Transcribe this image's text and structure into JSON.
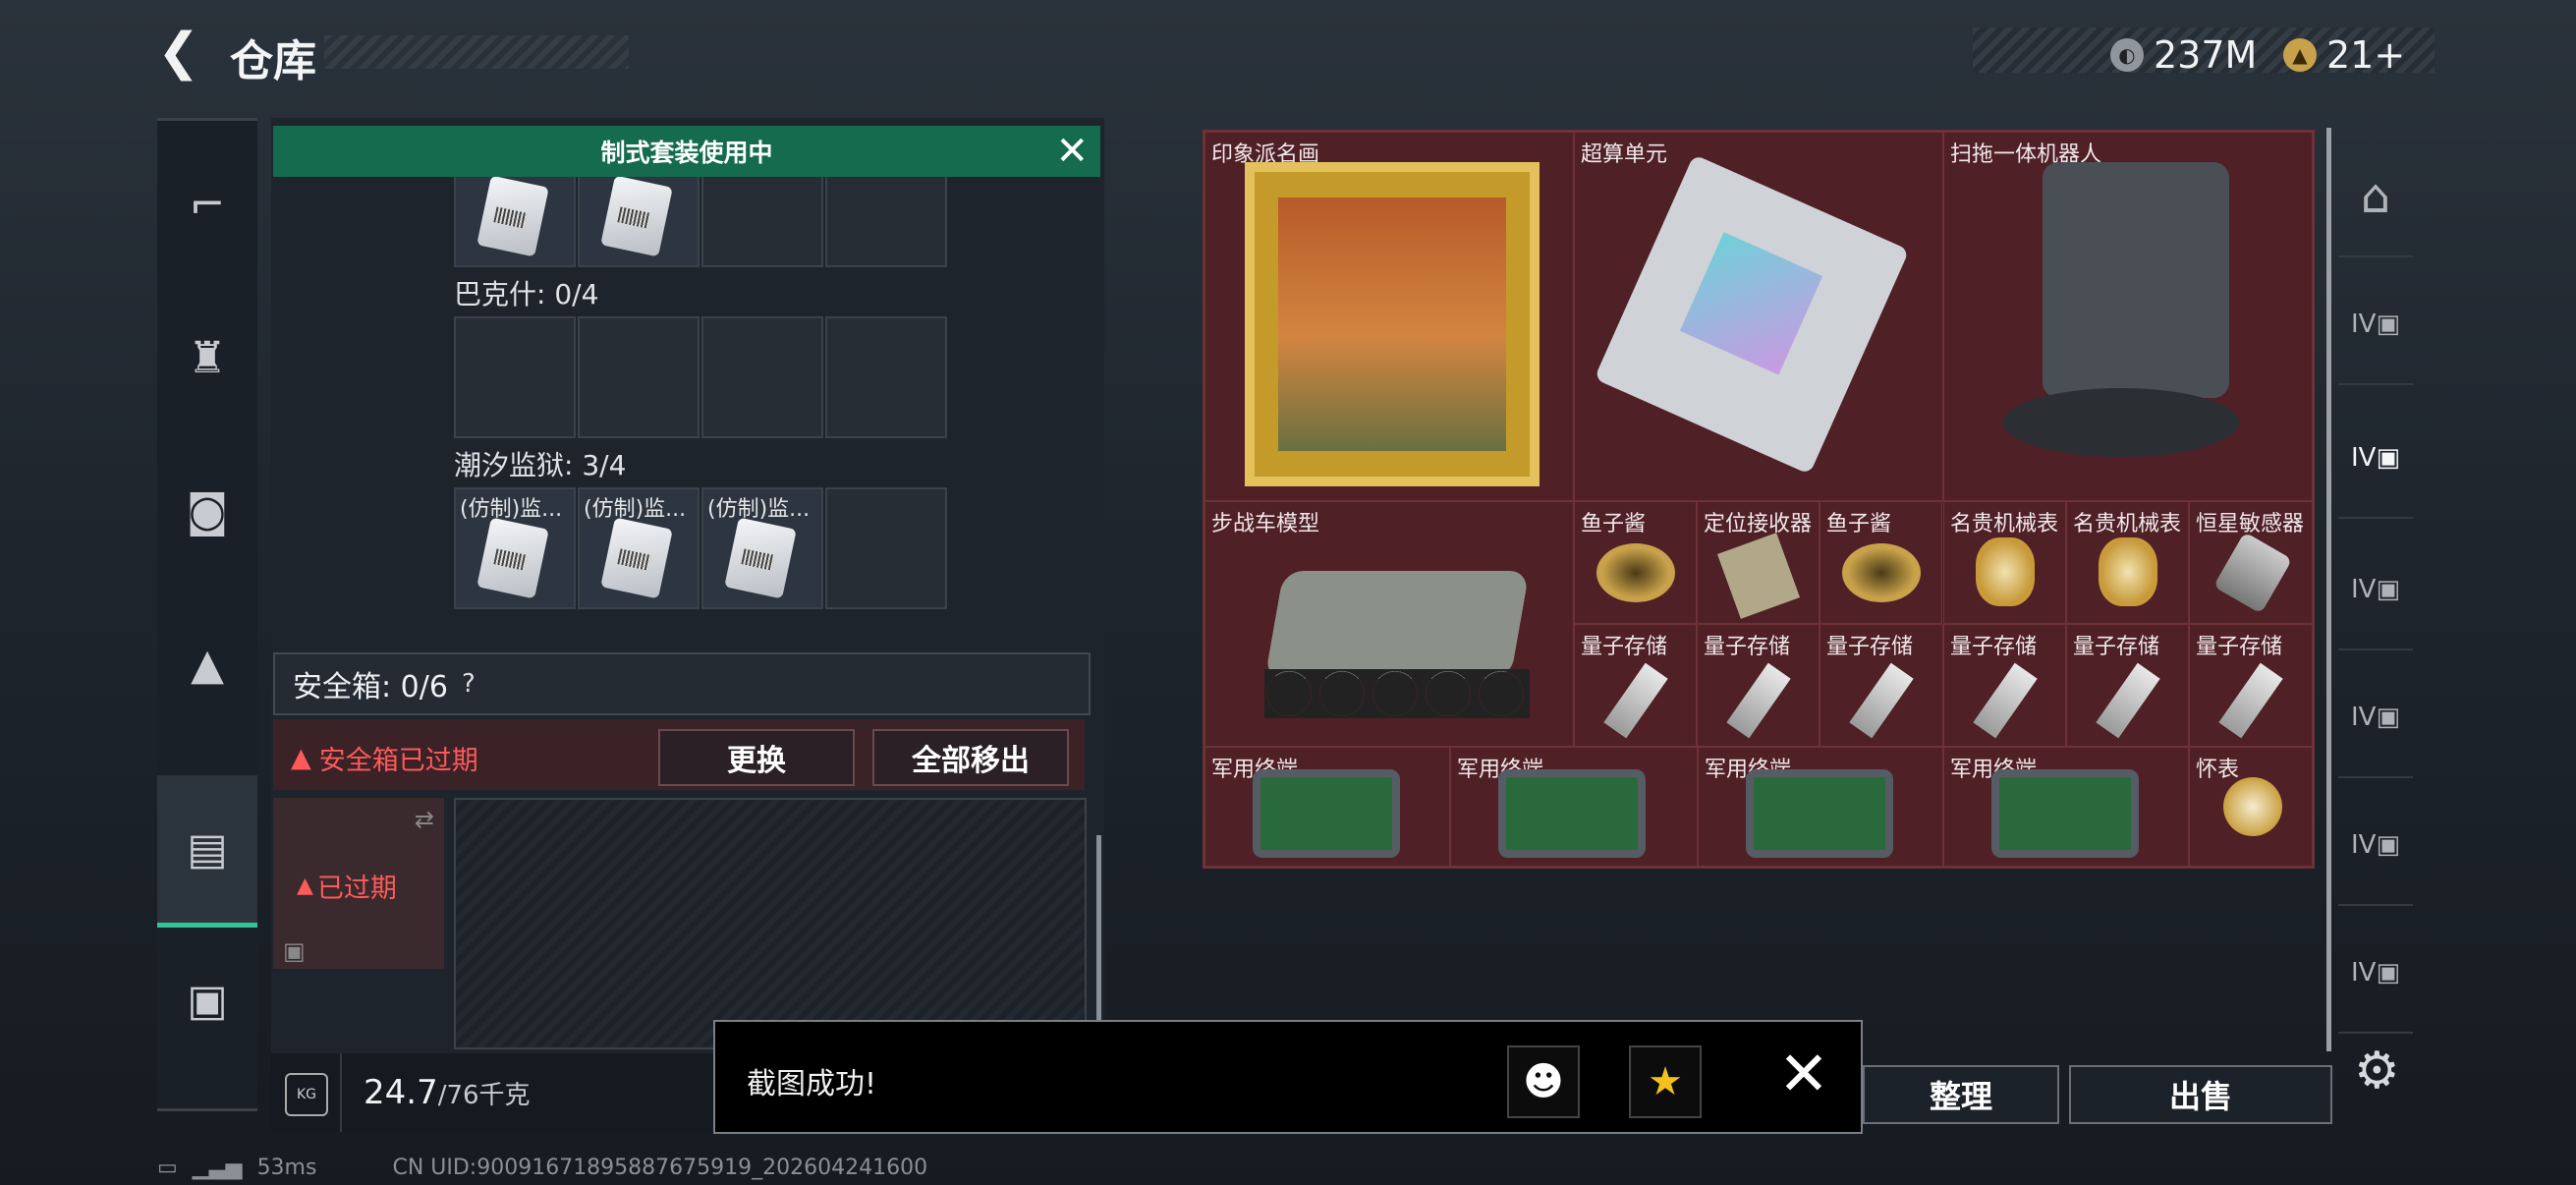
{
  "header": {
    "title": "仓库",
    "currency1_value": "237M",
    "currency2_value": "21+",
    "currency1_icon": "coin-icon",
    "currency2_icon": "ticket-icon"
  },
  "left_nav": {
    "items": [
      {
        "name": "weapon",
        "icon": "gun-icon",
        "glyph": "⌐"
      },
      {
        "name": "armor",
        "icon": "armor-vest-icon",
        "glyph": "♜"
      },
      {
        "name": "backpack",
        "icon": "backpack-icon",
        "glyph": "◙"
      },
      {
        "name": "helmet",
        "icon": "helmet-icon",
        "glyph": "▲"
      },
      {
        "name": "safebox",
        "icon": "clipboard-icon",
        "glyph": "▤",
        "active": true
      },
      {
        "name": "case",
        "icon": "briefcase-icon",
        "glyph": "▣"
      }
    ]
  },
  "left_panel": {
    "banner": "制式套装使用中",
    "section_bakeshi": "巴克什: 0/4",
    "section_chaoxi": "潮汐监狱: 3/4",
    "chaoxi_items": [
      "(仿制)监...",
      "(仿制)监...",
      "(仿制)监..."
    ],
    "safebox_label": "安全箱: 0/6",
    "help": "?",
    "expired_warning": "安全箱已过期",
    "btn_replace": "更换",
    "btn_remove_all": "全部移出",
    "expired_tag": "已过期",
    "weight_current": "24.7",
    "weight_total": "/76千克",
    "weight_icon_text": "KG"
  },
  "right_grid": {
    "items": [
      {
        "label": "印象派名画",
        "icon": "painting-icon"
      },
      {
        "label": "超算单元",
        "icon": "circuit-board-icon"
      },
      {
        "label": "扫拖一体机器人",
        "icon": "robot-vacuum-icon"
      },
      {
        "label": "步战车模型",
        "icon": "armored-vehicle-icon"
      },
      {
        "label": "鱼子酱",
        "icon": "caviar-tin-icon"
      },
      {
        "label": "定位接收器",
        "icon": "receiver-icon"
      },
      {
        "label": "鱼子酱",
        "icon": "caviar-tin-icon"
      },
      {
        "label": "名贵机械表",
        "icon": "watch-icon"
      },
      {
        "label": "名贵机械表",
        "icon": "watch-icon"
      },
      {
        "label": "恒星敏感器",
        "icon": "sensor-icon"
      },
      {
        "label": "量子存储",
        "icon": "usb-drive-icon"
      },
      {
        "label": "量子存储",
        "icon": "usb-drive-icon"
      },
      {
        "label": "量子存储",
        "icon": "usb-drive-icon"
      },
      {
        "label": "量子存储",
        "icon": "usb-drive-icon"
      },
      {
        "label": "量子存储",
        "icon": "usb-drive-icon"
      },
      {
        "label": "量子存储",
        "icon": "usb-drive-icon"
      },
      {
        "label": "军用终端",
        "icon": "military-terminal-icon"
      },
      {
        "label": "军用终端",
        "icon": "military-terminal-icon"
      },
      {
        "label": "军用终端",
        "icon": "military-terminal-icon"
      },
      {
        "label": "军用终端",
        "icon": "military-terminal-icon"
      },
      {
        "label": "怀表",
        "icon": "pocket-watch-icon"
      }
    ]
  },
  "right_nav": {
    "tiers": [
      "IV",
      "IV",
      "IV",
      "IV",
      "IV",
      "IV"
    ]
  },
  "actions": {
    "sort": "整理",
    "sell": "出售"
  },
  "toast": {
    "message": "截图成功!",
    "share1_icon": "qq-penguin-icon",
    "share2_icon": "qzone-star-icon"
  },
  "status": {
    "ping": "53ms",
    "uid": "CN UID:9009167189588767591​9_202604241600"
  },
  "colors": {
    "accent_green": "#146b4e",
    "item_red": "#4f2026",
    "warning_red": "#ff5a5a"
  }
}
